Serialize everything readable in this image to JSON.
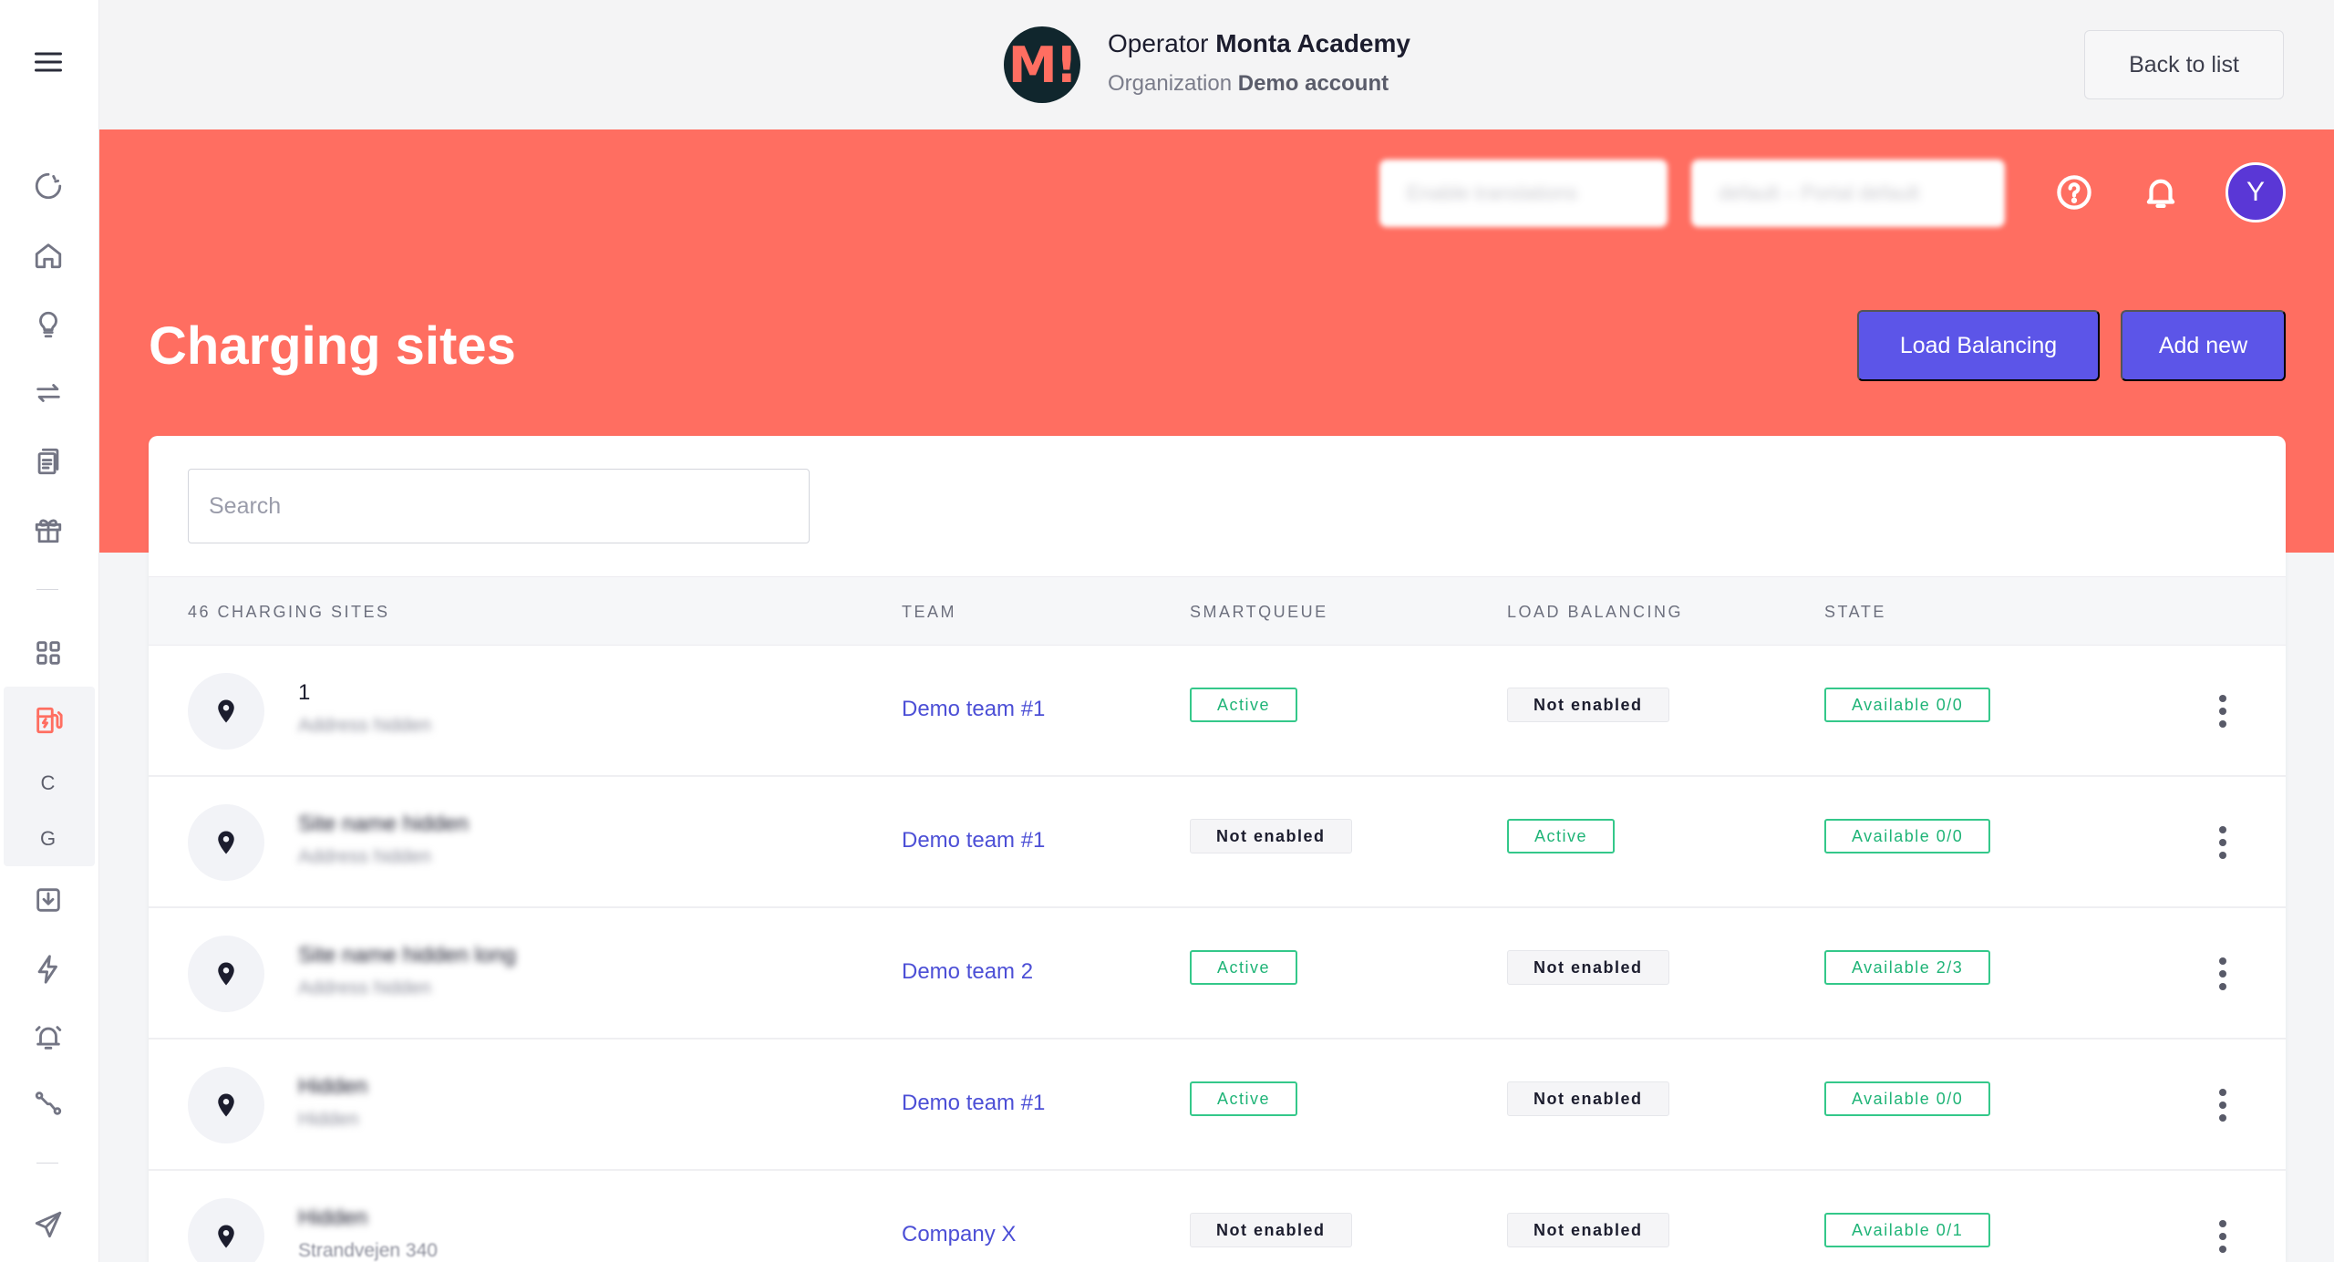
{
  "sidebar": {
    "menu_icon": "hamburger-icon",
    "items": [
      {
        "icon": "loading-circle-icon"
      },
      {
        "icon": "home-icon"
      },
      {
        "icon": "lightbulb-icon"
      },
      {
        "icon": "transfer-arrows-icon"
      },
      {
        "icon": "documents-icon"
      },
      {
        "icon": "gift-icon"
      },
      {
        "icon": "grid-icon"
      },
      {
        "icon": "charging-station-icon"
      },
      {
        "letter": "C"
      },
      {
        "letter": "G"
      },
      {
        "icon": "download-tray-icon"
      },
      {
        "icon": "lightning-icon"
      },
      {
        "icon": "alarm-bell-icon"
      },
      {
        "icon": "route-icon"
      },
      {
        "icon": "send-icon"
      }
    ]
  },
  "topbar": {
    "operator_prefix": "Operator",
    "operator_name": "Monta Academy",
    "organization_prefix": "Organization",
    "organization_name": "Demo account",
    "logo_text": "M!",
    "back_label": "Back to list"
  },
  "header": {
    "blurred_pill_1": "Enable translations",
    "blurred_pill_2": "default – Portal default",
    "avatar_letter": "Y",
    "title": "Charging sites",
    "load_balancing_label": "Load Balancing",
    "add_new_label": "Add new"
  },
  "search": {
    "placeholder": "Search",
    "value": ""
  },
  "table": {
    "columns": [
      "46 CHARGING SITES",
      "TEAM",
      "SMARTQUEUE",
      "LOAD BALANCING",
      "STATE"
    ],
    "rows": [
      {
        "name": "1",
        "address": "Address hidden",
        "name_blurred": false,
        "team": "Demo team #1",
        "smartqueue": "Active",
        "load_balancing": "Not enabled",
        "state": "Available 0/0"
      },
      {
        "name": "Site name hidden",
        "address": "Address hidden",
        "name_blurred": true,
        "team": "Demo team #1",
        "smartqueue": "Not enabled",
        "load_balancing": "Active",
        "state": "Available 0/0"
      },
      {
        "name": "Site name hidden long",
        "address": "Address hidden",
        "name_blurred": true,
        "team": "Demo team 2",
        "smartqueue": "Active",
        "load_balancing": "Not enabled",
        "state": "Available 2/3"
      },
      {
        "name": "Hidden",
        "address": "Hidden",
        "name_blurred": true,
        "team": "Demo team #1",
        "smartqueue": "Active",
        "load_balancing": "Not enabled",
        "state": "Available 0/0"
      },
      {
        "name": "Hidden",
        "address": "Strandvejen 340",
        "name_blurred": true,
        "team": "Company X",
        "smartqueue": "Not enabled",
        "load_balancing": "Not enabled",
        "state": "Available 0/1"
      }
    ]
  },
  "colors": {
    "brand_coral": "#ff6e61",
    "primary_button": "#5c55e8",
    "link": "#4c4fd6",
    "active_green": "#34c88a",
    "avatar_purple": "#5a37d6"
  }
}
